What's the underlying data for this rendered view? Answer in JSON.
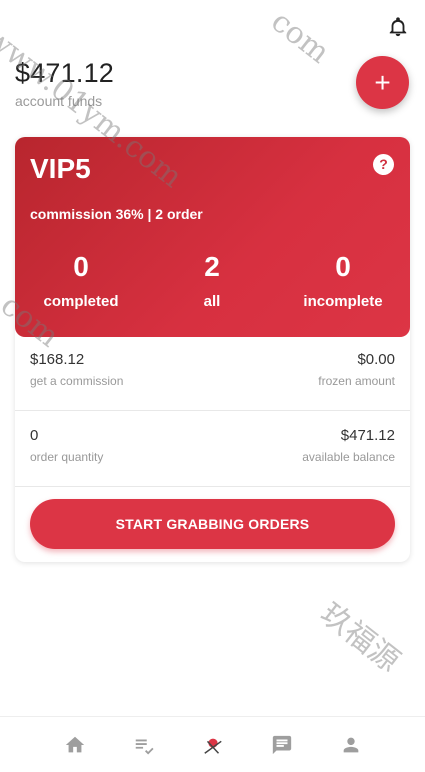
{
  "header": {
    "bell_icon": "bell-icon"
  },
  "account": {
    "amount": "$471.12",
    "label": "account funds"
  },
  "fab": {
    "label": "+"
  },
  "vip": {
    "title": "VIP5",
    "help_icon": "?",
    "subtitle": "commission 36% | 2 order",
    "stats": [
      {
        "value": "0",
        "label": "completed"
      },
      {
        "value": "2",
        "label": "all"
      },
      {
        "value": "0",
        "label": "incomplete"
      }
    ]
  },
  "details": {
    "commission": {
      "value": "$168.12",
      "label": "get a commission"
    },
    "frozen": {
      "value": "$0.00",
      "label": "frozen amount"
    },
    "quantity": {
      "value": "0",
      "label": "order quantity"
    },
    "balance": {
      "value": "$471.12",
      "label": "available balance"
    }
  },
  "actions": {
    "grab_label": "START GRABBING ORDERS"
  },
  "watermark": {
    "line1": "www.01ym.com",
    "line2": "com",
    "line3": ".com",
    "line4": "玖福源"
  },
  "colors": {
    "accent": "#dc3545"
  },
  "tabbar": {
    "items": [
      {
        "icon": "home-icon"
      },
      {
        "icon": "task-list-icon"
      },
      {
        "icon": "grab-logo-icon"
      },
      {
        "icon": "message-icon"
      },
      {
        "icon": "profile-icon"
      }
    ]
  }
}
